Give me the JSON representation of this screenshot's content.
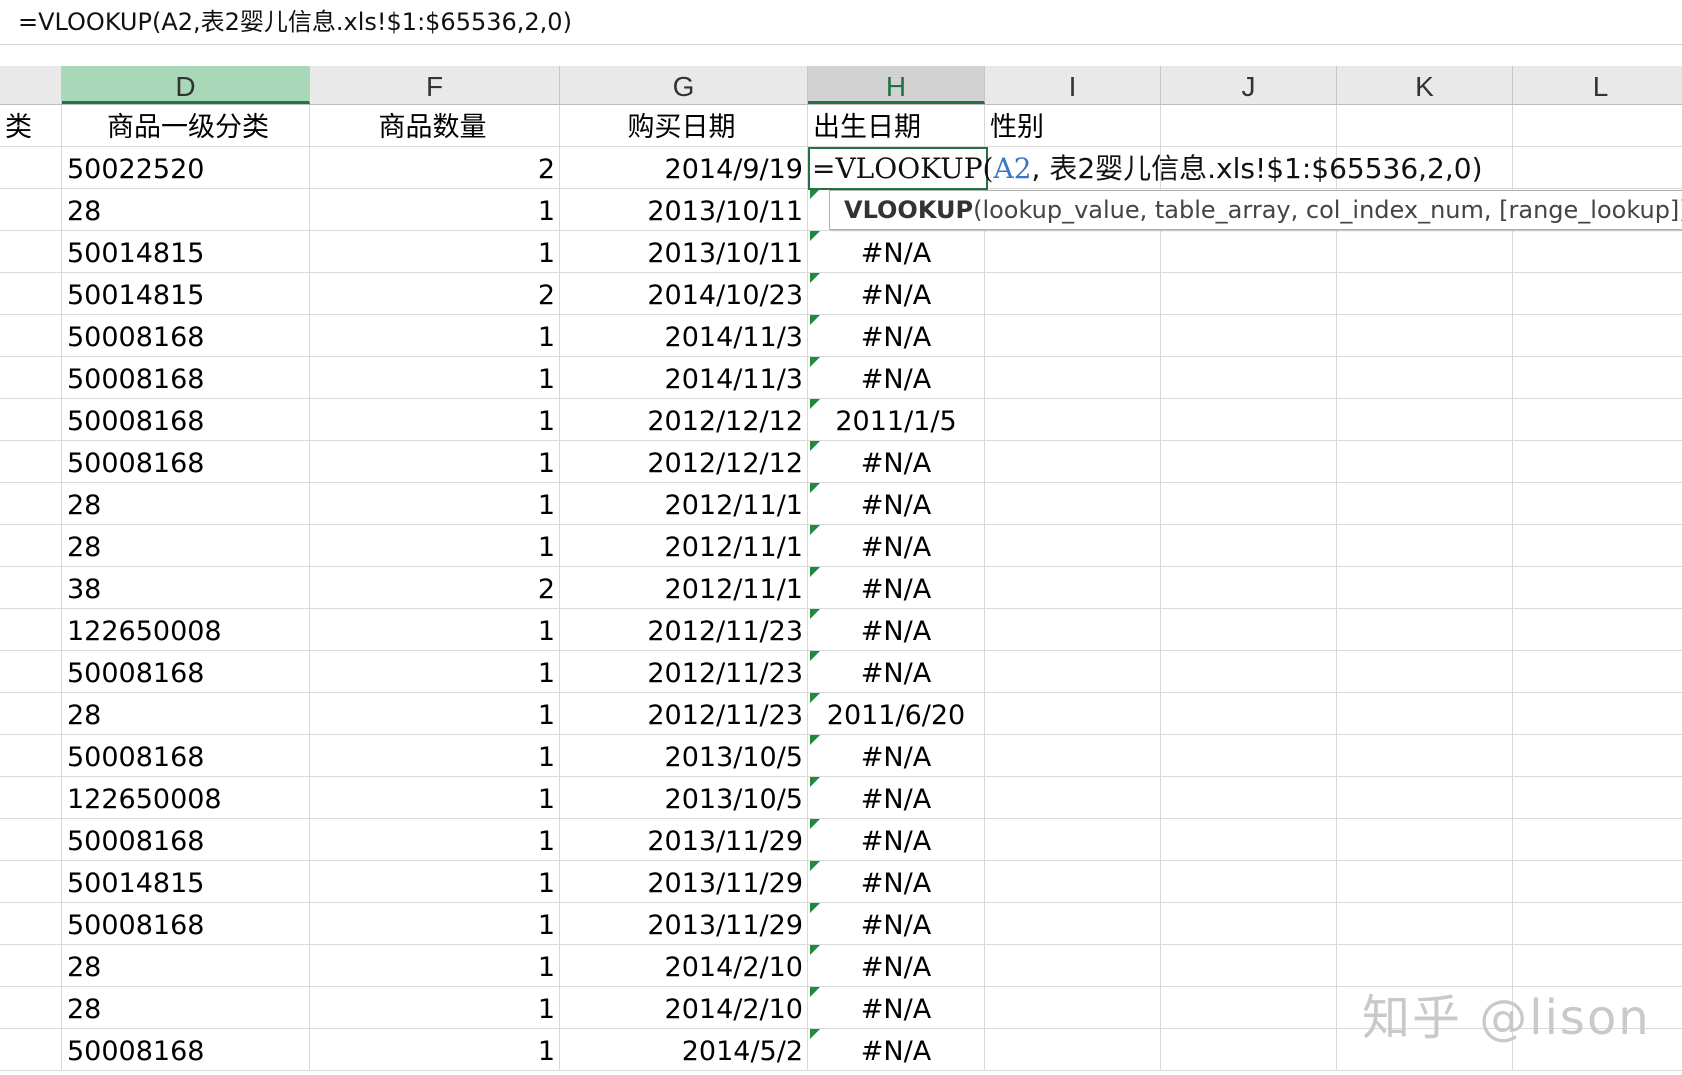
{
  "formula_bar": {
    "text": "=VLOOKUP(A2,表2婴儿信息.xls!$1:$65536,2,0)"
  },
  "columns": [
    "D",
    "F",
    "G",
    "H",
    "I",
    "J",
    "K",
    "L"
  ],
  "header_row": {
    "partial": "类",
    "D": "商品一级分类",
    "F": "商品数量",
    "G": "购买日期",
    "H": "出生日期",
    "I": "性别"
  },
  "active_cell": {
    "prefix": "=VLOOKUP(",
    "ref": "A2",
    "rest": ", 表2婴儿信息.xls!$1:$65536,2,0)"
  },
  "tooltip": {
    "function": "VLOOKUP",
    "args": "(lookup_value, table_array, col_index_num, [range_lookup])"
  },
  "rows": [
    {
      "D": "50022520",
      "F": "2",
      "G": "2014/9/19",
      "H": ""
    },
    {
      "D": "28",
      "F": "1",
      "G": "2013/10/11",
      "H": ""
    },
    {
      "D": "50014815",
      "F": "1",
      "G": "2013/10/11",
      "H": "#N/A"
    },
    {
      "D": "50014815",
      "F": "2",
      "G": "2014/10/23",
      "H": "#N/A"
    },
    {
      "D": "50008168",
      "F": "1",
      "G": "2014/11/3",
      "H": "#N/A"
    },
    {
      "D": "50008168",
      "F": "1",
      "G": "2014/11/3",
      "H": "#N/A"
    },
    {
      "D": "50008168",
      "F": "1",
      "G": "2012/12/12",
      "H": "2011/1/5"
    },
    {
      "D": "50008168",
      "F": "1",
      "G": "2012/12/12",
      "H": "#N/A"
    },
    {
      "D": "28",
      "F": "1",
      "G": "2012/11/1",
      "H": "#N/A"
    },
    {
      "D": "28",
      "F": "1",
      "G": "2012/11/1",
      "H": "#N/A"
    },
    {
      "D": "38",
      "F": "2",
      "G": "2012/11/1",
      "H": "#N/A"
    },
    {
      "D": "122650008",
      "F": "1",
      "G": "2012/11/23",
      "H": "#N/A"
    },
    {
      "D": "50008168",
      "F": "1",
      "G": "2012/11/23",
      "H": "#N/A"
    },
    {
      "D": "28",
      "F": "1",
      "G": "2012/11/23",
      "H": "2011/6/20"
    },
    {
      "D": "50008168",
      "F": "1",
      "G": "2013/10/5",
      "H": "#N/A"
    },
    {
      "D": "122650008",
      "F": "1",
      "G": "2013/10/5",
      "H": "#N/A"
    },
    {
      "D": "50008168",
      "F": "1",
      "G": "2013/11/29",
      "H": "#N/A"
    },
    {
      "D": "50014815",
      "F": "1",
      "G": "2013/11/29",
      "H": "#N/A"
    },
    {
      "D": "50008168",
      "F": "1",
      "G": "2013/11/29",
      "H": "#N/A"
    },
    {
      "D": "28",
      "F": "1",
      "G": "2014/2/10",
      "H": "#N/A"
    },
    {
      "D": "28",
      "F": "1",
      "G": "2014/2/10",
      "H": "#N/A"
    },
    {
      "D": "50008168",
      "F": "1",
      "G": "2014/5/2",
      "H": "#N/A"
    }
  ],
  "watermark": "知乎 @lison"
}
